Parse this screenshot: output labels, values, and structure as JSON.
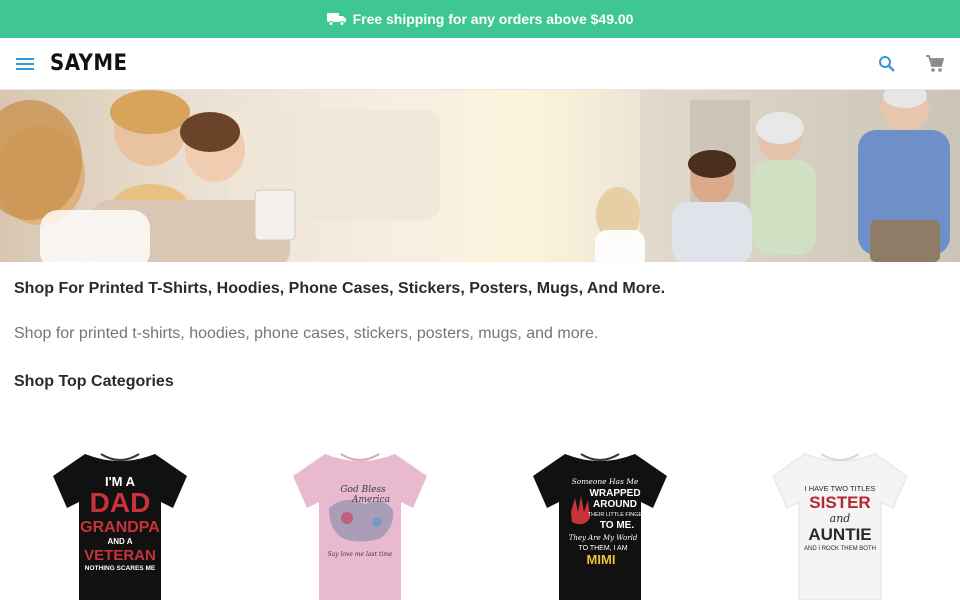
{
  "promo": {
    "icon": "truck-icon",
    "text": "Free shipping for any orders above $49.00",
    "background": "#3ec694"
  },
  "header": {
    "brand": "SAYME",
    "menu_icon": "menu-icon",
    "search_icon": "search-icon",
    "cart_icon": "cart-icon",
    "accent": "#2f9ad6"
  },
  "hero": {
    "description": "Families with children and grandparents"
  },
  "main": {
    "headline": "Shop For Printed T-Shirts, Hoodies, Phone Cases, Stickers, Posters, Mugs, And More.",
    "subline": "Shop for printed t-shirts, hoodies, phone cases, stickers, posters, mugs, and more.",
    "section_title": "Shop Top Categories"
  },
  "categories": [
    {
      "shirt_color": "#111111",
      "print_lines": [
        "I'M A",
        "DAD",
        "GRANDPA",
        "AND A",
        "VETERAN",
        "NOTHING SCARES ME"
      ]
    },
    {
      "shirt_color": "#e8b9cf",
      "print_lines": [
        "God Bless",
        "America",
        "Say love me last time"
      ]
    },
    {
      "shirt_color": "#111111",
      "print_lines": [
        "Someone Has Me",
        "WRAPPED",
        "AROUND",
        "THEIR LITTLE FINGER",
        "TO ME.",
        "They Are My World",
        "TO THEM, I AM",
        "MIMI"
      ]
    },
    {
      "shirt_color": "#f4f4f4",
      "print_lines": [
        "I HAVE TWO TITLES",
        "SISTER",
        "and",
        "AUNTIE",
        "AND I ROCK THEM BOTH"
      ]
    }
  ]
}
